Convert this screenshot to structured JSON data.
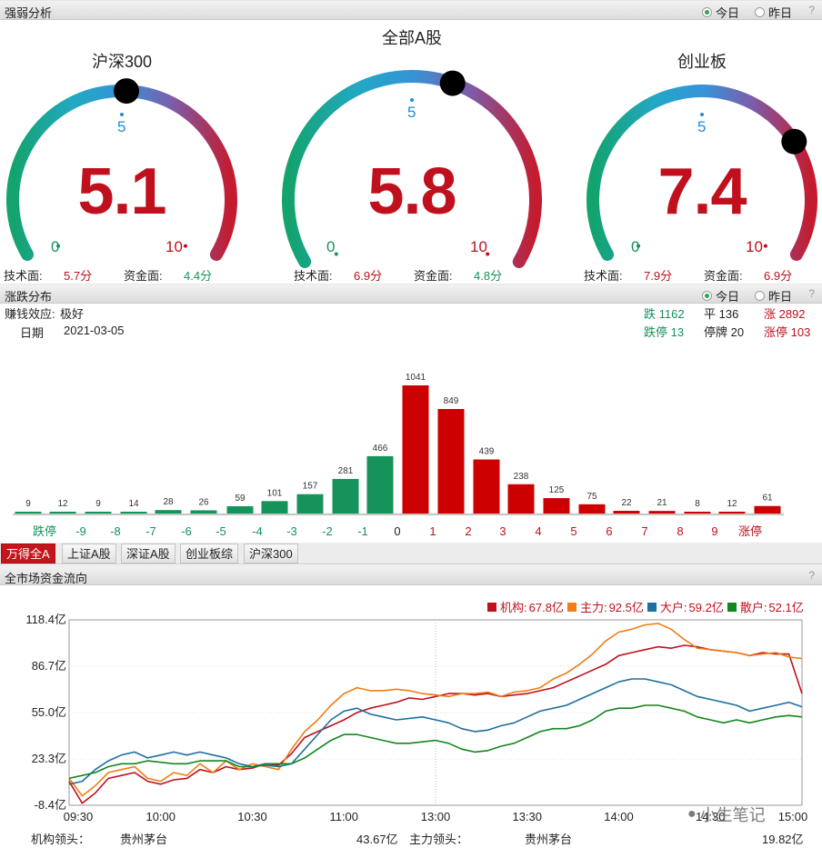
{
  "strength": {
    "title": "强弱分析",
    "help": "?",
    "radio_today": "今日",
    "radio_yesterday": "昨日",
    "gauges": [
      {
        "title": "沪深300",
        "value": "5.1",
        "score": 5.1,
        "mid": "5",
        "low": "0",
        "high": "10",
        "tech_label": "技术面:",
        "tech_value": "5.7分",
        "fund_label": "资金面:",
        "fund_value": "4.4分"
      },
      {
        "title": "全部A股",
        "value": "5.8",
        "score": 5.8,
        "mid": "5",
        "low": "0",
        "high": "10",
        "tech_label": "技术面:",
        "tech_value": "6.9分",
        "fund_label": "资金面:",
        "fund_value": "4.8分"
      },
      {
        "title": "创业板",
        "value": "7.4",
        "score": 7.4,
        "mid": "5",
        "low": "0",
        "high": "10",
        "tech_label": "技术面:",
        "tech_value": "7.9分",
        "fund_label": "资金面:",
        "fund_value": "6.9分"
      }
    ]
  },
  "distribution": {
    "title": "涨跌分布",
    "help": "?",
    "radio_today": "今日",
    "radio_yesterday": "昨日",
    "effect_label": "赚钱效应:",
    "effect_value": "极好",
    "date_label": "日期",
    "date_value": "2021-03-05",
    "down": "跌 1162",
    "flat": "平 136",
    "up": "涨 2892",
    "limit_down": "跌停 13",
    "suspended": "停牌 20",
    "limit_up": "涨停 103"
  },
  "tabs": [
    "万得全A",
    "上证A股",
    "深证A股",
    "创业板综",
    "沪深300"
  ],
  "flow": {
    "title": "全市场资金流向",
    "help": "?",
    "legend": [
      {
        "name": "机构:",
        "value": "67.8亿",
        "color": "#c0101e"
      },
      {
        "name": "主力:",
        "value": "92.5亿",
        "color": "#f07d16"
      },
      {
        "name": "大户:",
        "value": "59.2亿",
        "color": "#1f6fa0"
      },
      {
        "name": "散户:",
        "value": "52.1亿",
        "color": "#14861e"
      }
    ],
    "inst_lead_label": "机构领头：",
    "inst_lead_stock": "贵州茅台",
    "inst_lead_value": "43.67亿",
    "main_lead_label": "主力领头：",
    "main_lead_stock": "贵州茅台",
    "main_lead_value": "19.82亿",
    "watermark": "小生笔记"
  },
  "chart_data": [
    {
      "type": "bar",
      "categories": [
        "跌停",
        "-9",
        "-8",
        "-7",
        "-6",
        "-5",
        "-4",
        "-3",
        "-2",
        "-1",
        "0",
        "1",
        "2",
        "3",
        "4",
        "5",
        "6",
        "7",
        "8",
        "9",
        "涨停"
      ],
      "values": [
        9,
        12,
        9,
        14,
        28,
        26,
        59,
        101,
        157,
        281,
        466,
        null,
        1041,
        849,
        439,
        238,
        125,
        75,
        22,
        21,
        8,
        12,
        61
      ],
      "bars": [
        {
          "pos": 0,
          "value": 9,
          "color": "#14935a"
        },
        {
          "pos": 1,
          "value": 12,
          "color": "#14935a"
        },
        {
          "pos": 2,
          "value": 9,
          "color": "#14935a"
        },
        {
          "pos": 3,
          "value": 14,
          "color": "#14935a"
        },
        {
          "pos": 4,
          "value": 28,
          "color": "#14935a"
        },
        {
          "pos": 5,
          "value": 26,
          "color": "#14935a"
        },
        {
          "pos": 6,
          "value": 59,
          "color": "#14935a"
        },
        {
          "pos": 7,
          "value": 101,
          "color": "#14935a"
        },
        {
          "pos": 8,
          "value": 157,
          "color": "#14935a"
        },
        {
          "pos": 9,
          "value": 281,
          "color": "#14935a"
        },
        {
          "pos": 10,
          "value": 466,
          "color": "#14935a"
        },
        {
          "pos": 11,
          "value": 1041,
          "color": "#cc0000"
        },
        {
          "pos": 12,
          "value": 849,
          "color": "#cc0000"
        },
        {
          "pos": 13,
          "value": 439,
          "color": "#cc0000"
        },
        {
          "pos": 14,
          "value": 238,
          "color": "#cc0000"
        },
        {
          "pos": 15,
          "value": 125,
          "color": "#cc0000"
        },
        {
          "pos": 16,
          "value": 75,
          "color": "#cc0000"
        },
        {
          "pos": 17,
          "value": 22,
          "color": "#cc0000"
        },
        {
          "pos": 18,
          "value": 21,
          "color": "#cc0000"
        },
        {
          "pos": 19,
          "value": 8,
          "color": "#cc0000"
        },
        {
          "pos": 20,
          "value": 12,
          "color": "#cc0000"
        },
        {
          "pos": 21,
          "value": 61,
          "color": "#cc0000"
        }
      ],
      "labels": [
        {
          "text": "跌停",
          "color": "#14935a"
        },
        {
          "text": "-9",
          "color": "#14935a"
        },
        {
          "text": "-8",
          "color": "#14935a"
        },
        {
          "text": "-7",
          "color": "#14935a"
        },
        {
          "text": "-6",
          "color": "#14935a"
        },
        {
          "text": "-5",
          "color": "#14935a"
        },
        {
          "text": "-4",
          "color": "#14935a"
        },
        {
          "text": "-3",
          "color": "#14935a"
        },
        {
          "text": "-2",
          "color": "#14935a"
        },
        {
          "text": "-1",
          "color": "#14935a"
        },
        {
          "text": "0",
          "color": "#222222"
        },
        {
          "text": "1",
          "color": "#c0101e"
        },
        {
          "text": "2",
          "color": "#c0101e"
        },
        {
          "text": "3",
          "color": "#c0101e"
        },
        {
          "text": "4",
          "color": "#c0101e"
        },
        {
          "text": "5",
          "color": "#c0101e"
        },
        {
          "text": "6",
          "color": "#c0101e"
        },
        {
          "text": "7",
          "color": "#c0101e"
        },
        {
          "text": "8",
          "color": "#c0101e"
        },
        {
          "text": "9",
          "color": "#c0101e"
        },
        {
          "text": "涨停",
          "color": "#c0101e"
        }
      ]
    },
    {
      "type": "line",
      "x_ticks": [
        "09:30",
        "10:00",
        "10:30",
        "11:00",
        "13:00",
        "13:30",
        "14:00",
        "14:30",
        "15:00"
      ],
      "y_ticks": [
        "118.4亿",
        "86.7亿",
        "55.0亿",
        "23.3亿",
        "-8.4亿"
      ],
      "ylim": [
        -8.4,
        118.4
      ],
      "series": [
        {
          "name": "机构",
          "color": "#c0101e",
          "values": [
            8,
            -7,
            0,
            10,
            12,
            14,
            8,
            6,
            9,
            10,
            16,
            14,
            18,
            16,
            17,
            20,
            19,
            27,
            38,
            42,
            46,
            50,
            55,
            58,
            60,
            62,
            65,
            64,
            66,
            68,
            68,
            67,
            68,
            66,
            67,
            68,
            70,
            72,
            76,
            80,
            84,
            88,
            94,
            96,
            98,
            100,
            99,
            101,
            100,
            98,
            97,
            96,
            94,
            96,
            95,
            95,
            68
          ]
        },
        {
          "name": "主力",
          "color": "#f07d16",
          "values": [
            10,
            -2,
            5,
            14,
            16,
            18,
            10,
            8,
            14,
            12,
            20,
            14,
            22,
            16,
            20,
            18,
            16,
            30,
            42,
            50,
            60,
            68,
            72,
            70,
            70,
            71,
            70,
            68,
            67,
            66,
            68,
            68,
            69,
            66,
            69,
            70,
            72,
            78,
            82,
            88,
            95,
            104,
            110,
            112,
            115,
            116,
            112,
            105,
            99,
            98,
            97,
            96,
            94,
            95,
            96,
            93,
            92
          ]
        },
        {
          "name": "大户",
          "color": "#1f6fa0",
          "values": [
            6,
            8,
            16,
            22,
            26,
            28,
            24,
            26,
            28,
            26,
            28,
            26,
            24,
            20,
            18,
            19,
            18,
            20,
            30,
            40,
            50,
            56,
            58,
            54,
            52,
            50,
            51,
            52,
            50,
            48,
            44,
            42,
            43,
            46,
            48,
            52,
            56,
            58,
            60,
            64,
            68,
            72,
            76,
            78,
            78,
            76,
            74,
            70,
            66,
            64,
            62,
            60,
            56,
            58,
            60,
            62,
            59
          ]
        },
        {
          "name": "散户",
          "color": "#14861e",
          "values": [
            10,
            12,
            14,
            18,
            20,
            20,
            22,
            21,
            20,
            20,
            22,
            22,
            22,
            18,
            18,
            20,
            20,
            20,
            24,
            30,
            36,
            40,
            40,
            38,
            36,
            34,
            34,
            35,
            36,
            34,
            30,
            28,
            29,
            32,
            34,
            38,
            42,
            44,
            44,
            46,
            50,
            56,
            58,
            58,
            60,
            60,
            58,
            56,
            52,
            50,
            48,
            50,
            48,
            50,
            52,
            53,
            52
          ]
        }
      ]
    }
  ]
}
